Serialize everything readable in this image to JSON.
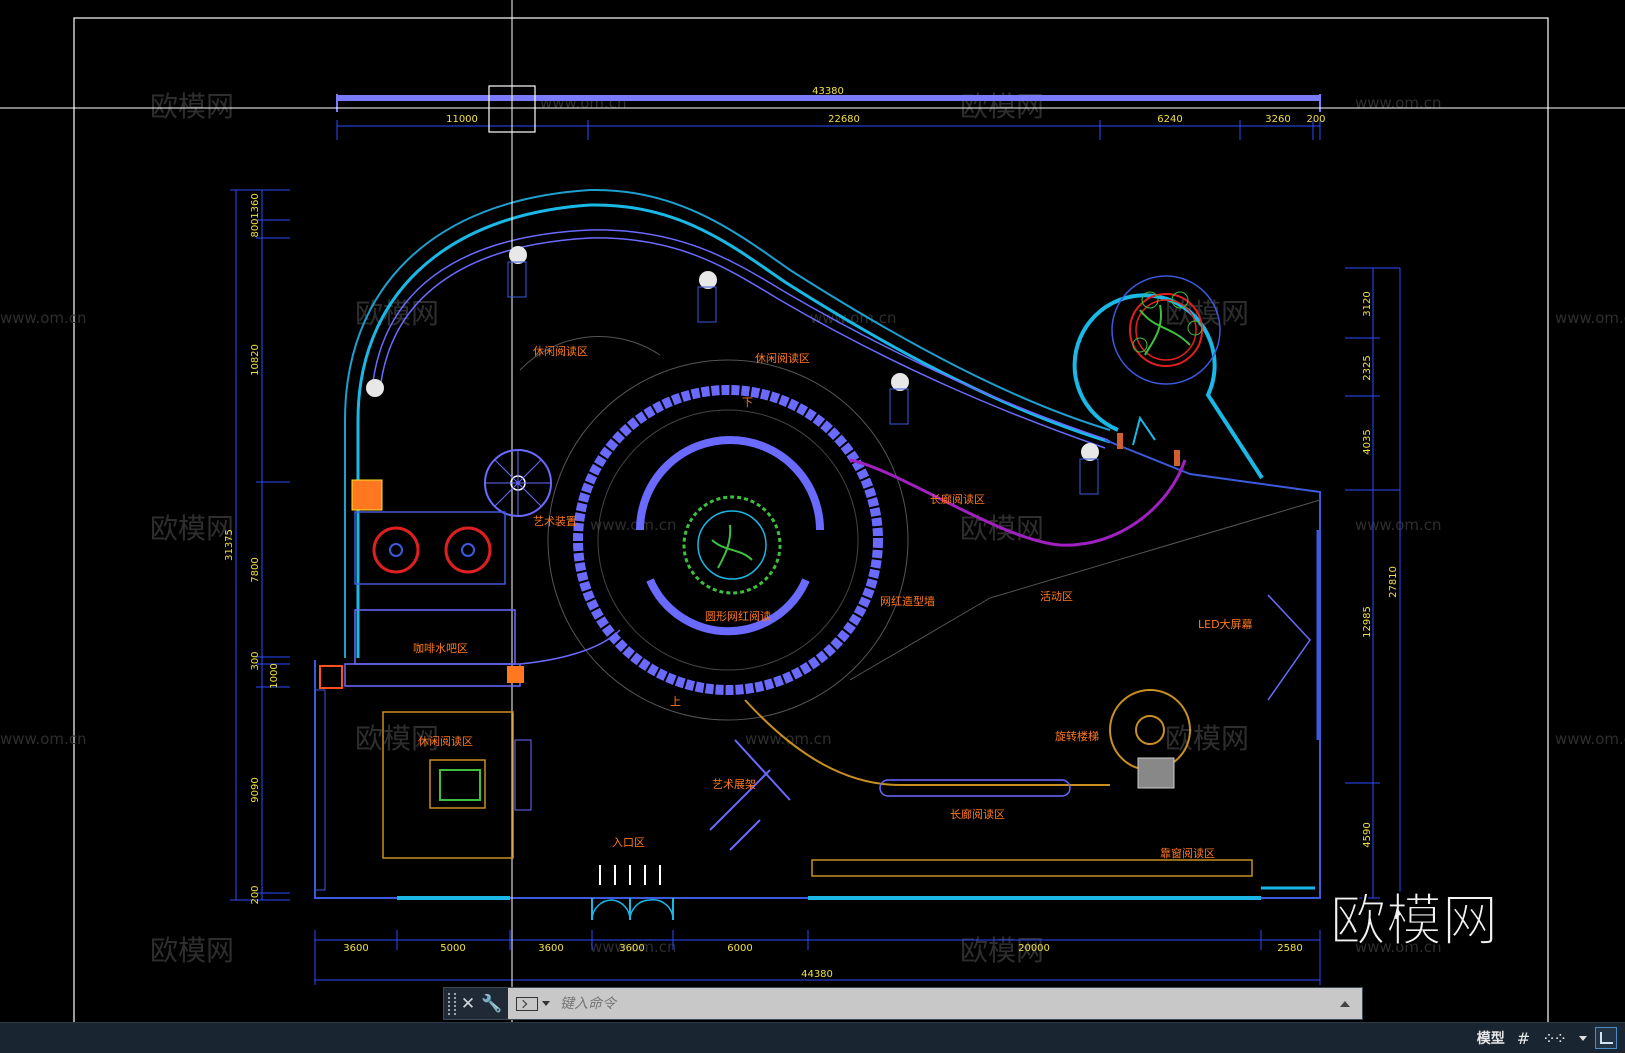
{
  "drawing": {
    "dims_top": {
      "overall": "43380",
      "segments": [
        "11000",
        "22680",
        "6240",
        "3260",
        "200"
      ]
    },
    "dims_bottom": {
      "overall": "44380",
      "segments": [
        "3600",
        "5000",
        "3600",
        "3600",
        "6000",
        "20000",
        "2580"
      ]
    },
    "dims_left": {
      "overall": "31375",
      "segments": [
        "800",
        "1360",
        "10820",
        "7800",
        "300",
        "1000",
        "9090",
        "200"
      ]
    },
    "dims_right": {
      "overall": "27810",
      "segments": [
        "3120",
        "2325",
        "4035",
        "12985",
        "4590"
      ]
    },
    "labels": {
      "leisure_reading_1": "休闲阅读区",
      "leisure_reading_2": "休闲阅读区",
      "leisure_reading_3": "休闲阅读区",
      "long_reading_1": "长廊阅读区",
      "long_reading_2": "长廊阅读区",
      "window_reading": "靠窗阅读区",
      "art_installation": "艺术装置",
      "circular_reading": "圆形网红阅读",
      "photo_spot": "网红造型墙",
      "event_area": "活动区",
      "led_screen": "LED大屏幕",
      "coffee_bar": "咖啡水吧区",
      "art_display": "艺术展架",
      "entrance": "入口区",
      "spiral_stair": "旋转楼梯",
      "down": "下",
      "up": "上"
    },
    "watermark_text": "www.om.cn",
    "watermark_logo": "欧模网",
    "brand_logo": "欧模网"
  },
  "command": {
    "placeholder": "键入命令"
  },
  "status": {
    "model": "模型",
    "grid_icon": "grid-icon",
    "snap_icon": "snap-icon"
  },
  "colors": {
    "wall_cyan": "#19b8e6",
    "wall_blue": "#3c5adc",
    "dim_yellow": "#f0e040",
    "label_orange": "#ff7820",
    "plant_green": "#3fbf3f",
    "purple": "#a020c0",
    "brown": "#c89020"
  }
}
